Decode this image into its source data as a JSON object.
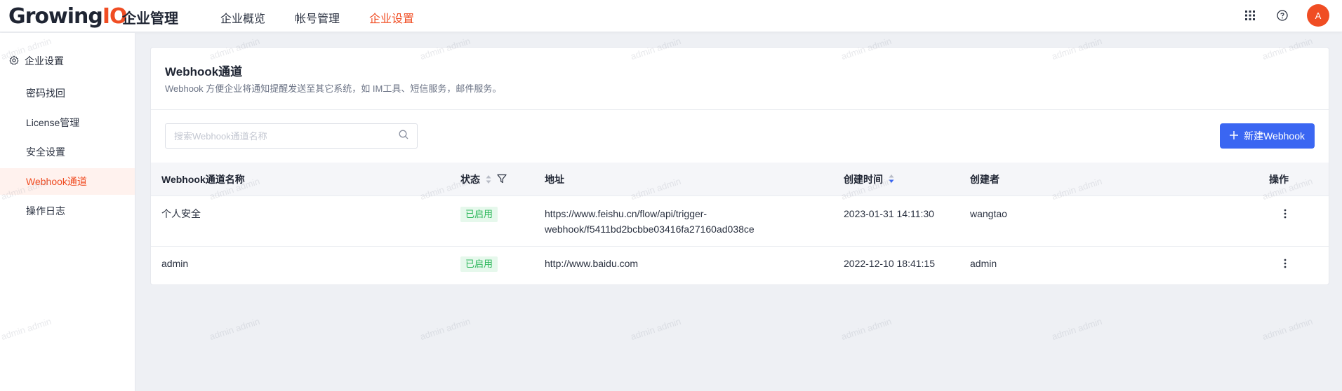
{
  "header": {
    "logo_main": "Growing",
    "logo_accent": "IO",
    "app_title": "企业管理",
    "nav": [
      {
        "label": "企业概览",
        "active": false
      },
      {
        "label": "帐号管理",
        "active": false
      },
      {
        "label": "企业设置",
        "active": true
      }
    ],
    "icons": [
      "apps-grid-icon",
      "help-icon"
    ],
    "avatar_initial": "A"
  },
  "sidebar": {
    "header_label": "企业设置",
    "header_icon": "gear-icon",
    "items": [
      {
        "label": "密码找回",
        "active": false
      },
      {
        "label": "License管理",
        "active": false
      },
      {
        "label": "安全设置",
        "active": false
      },
      {
        "label": "Webhook通道",
        "active": true
      },
      {
        "label": "操作日志",
        "active": false
      }
    ]
  },
  "main": {
    "title": "Webhook通道",
    "description": "Webhook 方便企业将通知提醒发送至其它系统，如 IM工具、短信服务，邮件服务。",
    "search": {
      "placeholder": "搜索Webhook通道名称",
      "value": ""
    },
    "new_button_label": "新建Webhook",
    "table": {
      "columns": [
        "Webhook通道名称",
        "状态",
        "地址",
        "创建时间",
        "创建者",
        "操作"
      ],
      "rows": [
        {
          "name": "个人安全",
          "status": "已启用",
          "url_line1": "https://www.feishu.cn/flow/api/trigger-",
          "url_line2": "webhook/f5411bd2bcbbe03416fa27160ad038ce",
          "created": "2023-01-31 14:11:30",
          "creator": "wangtao"
        },
        {
          "name": "admin",
          "status": "已启用",
          "url_line1": "http://www.baidu.com",
          "url_line2": "",
          "created": "2022-12-10 18:41:15",
          "creator": "admin"
        }
      ]
    }
  },
  "watermark": "admin admin",
  "colors": {
    "brand": "#f04d23",
    "primary": "#3a66f2",
    "success": "#2eb85c",
    "background": "#eef0f4"
  }
}
